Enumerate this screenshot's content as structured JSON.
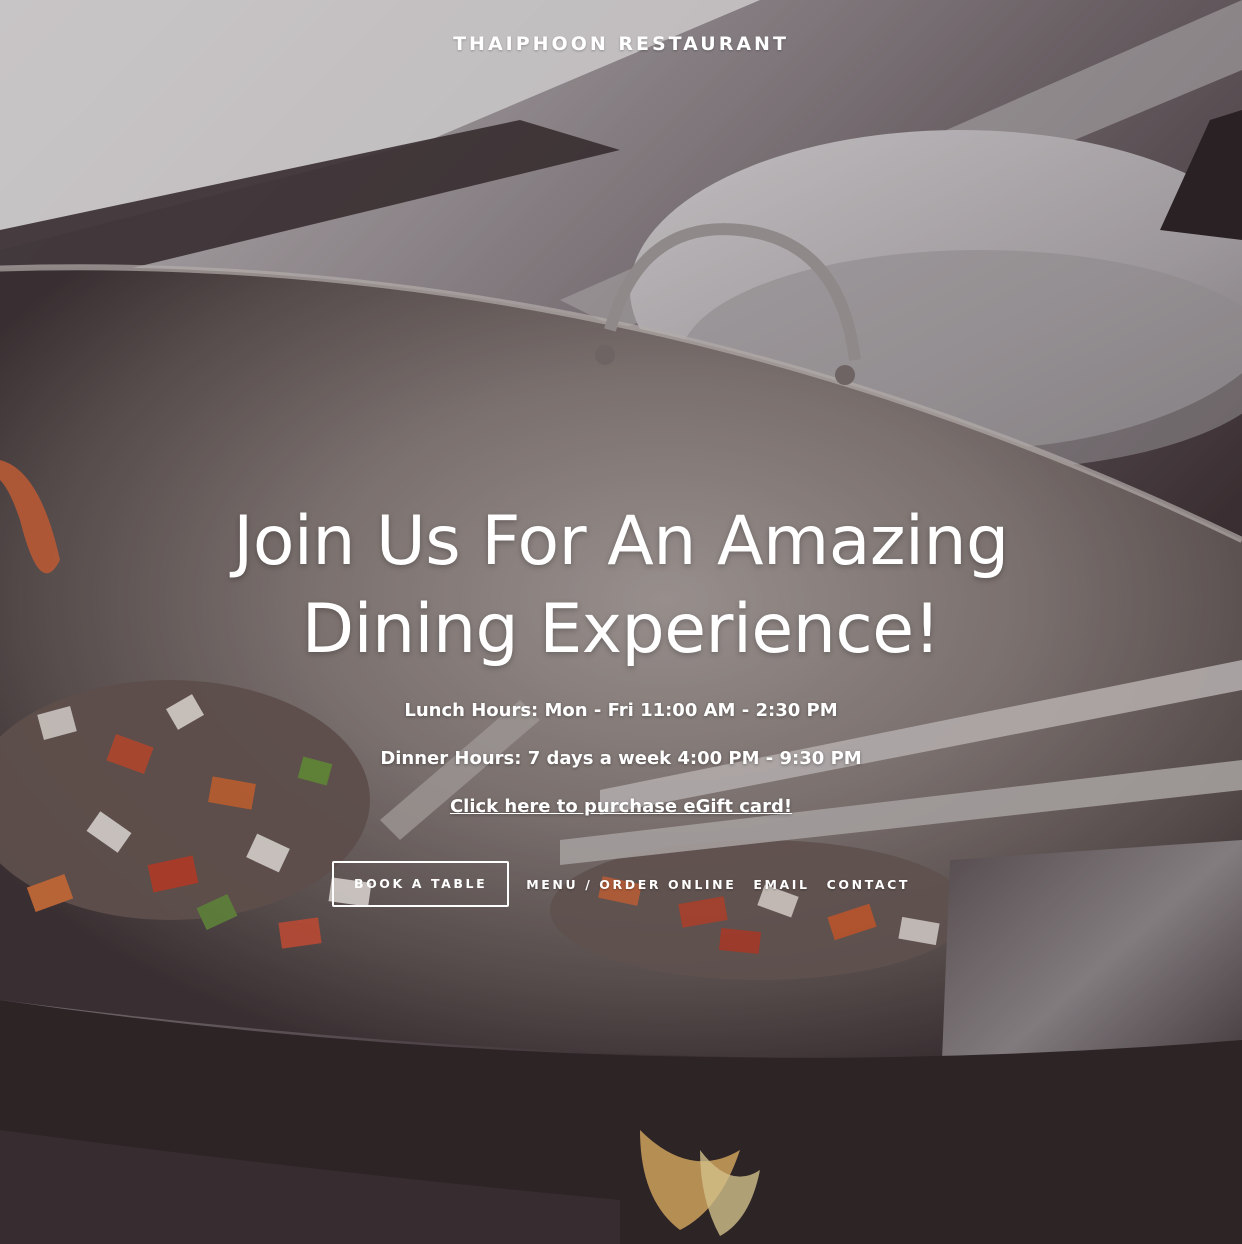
{
  "header": {
    "site_title": "THAIPHOON RESTAURANT"
  },
  "hero": {
    "background": "stir-fry-wok-photo",
    "headline": "Join Us For An Amazing Dining Experience!",
    "lunch_hours": "Lunch Hours: Mon - Fri 11:00 AM - 2:30 PM",
    "dinner_hours": "Dinner Hours: 7 days a week 4:00 PM - 9:30 PM",
    "gift_link": "Click here to purchase  eGift card!"
  },
  "nav": {
    "book_table": "BOOK A TABLE",
    "links": [
      "MENU / ORDER ONLINE",
      "EMAIL",
      "CONTACT"
    ]
  },
  "colors": {
    "text": "#ffffff",
    "overlay": "#281c20"
  }
}
